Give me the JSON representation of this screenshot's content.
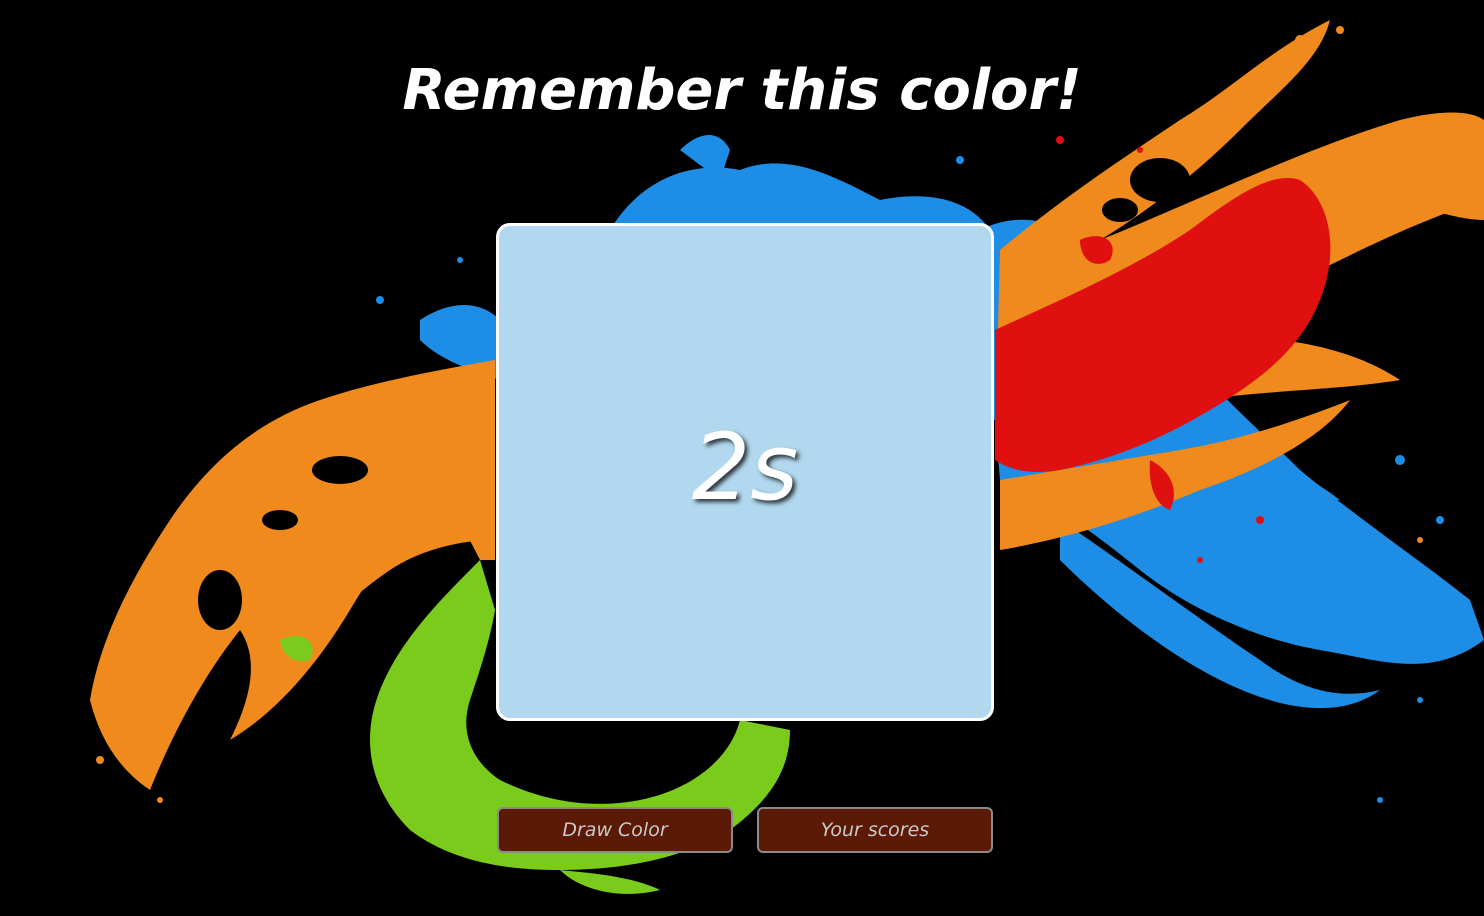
{
  "game": {
    "title": "Remember this color!",
    "countdown": "2s",
    "swatch_color": "#b1d8ee"
  },
  "buttons": {
    "draw_label": "Draw Color",
    "scores_label": "Your scores"
  },
  "background": {
    "description_colors": {
      "orange": "#f08a1c",
      "red": "#e01010",
      "blue": "#1e8de6",
      "green": "#7acb1c"
    }
  }
}
